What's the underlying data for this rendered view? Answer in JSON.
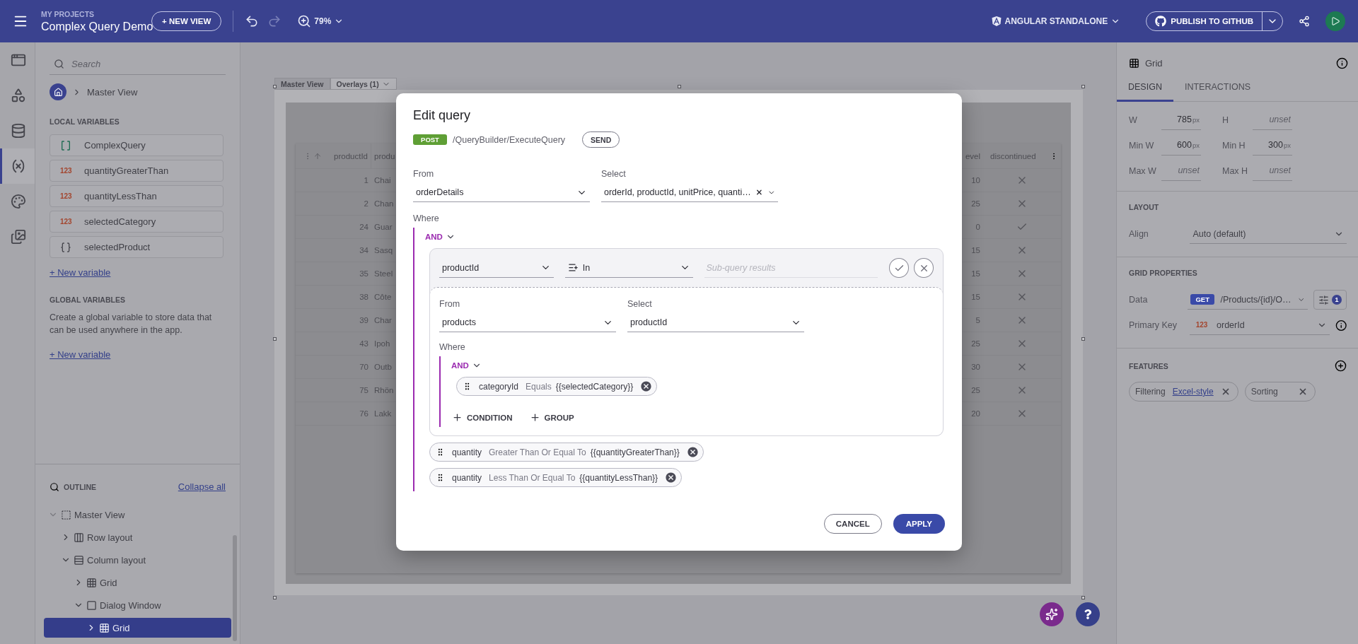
{
  "topbar": {
    "section": "MY PROJECTS",
    "project": "Complex Query Demo",
    "new_view": "+ NEW VIEW",
    "zoom": "79%",
    "framework": "ANGULAR STANDALONE",
    "publish": "PUBLISH TO GITHUB"
  },
  "rail": [
    {
      "kind": "views",
      "selected": false
    },
    {
      "kind": "components",
      "selected": false
    },
    {
      "kind": "data",
      "selected": false
    },
    {
      "kind": "variables",
      "selected": true
    },
    {
      "kind": "theme",
      "selected": false
    },
    {
      "kind": "assets",
      "selected": false
    }
  ],
  "left_panel": {
    "search_placeholder": "Search",
    "breadcrumb": "Master View",
    "local_title": "LOCAL VARIABLES",
    "variables": [
      {
        "kind": "query",
        "name": "ComplexQuery"
      },
      {
        "kind": "number",
        "badge": "123",
        "name": "quantityGreaterThan"
      },
      {
        "kind": "number",
        "badge": "123",
        "name": "quantityLessThan"
      },
      {
        "kind": "number",
        "badge": "123",
        "name": "selectedCategory"
      },
      {
        "kind": "object",
        "name": "selectedProduct"
      }
    ],
    "new_variable": "+ New variable",
    "global_title": "GLOBAL VARIABLES",
    "global_text": "Create a global variable to store data that can be used anywhere in the app.",
    "global_new_variable": "+ New variable"
  },
  "outline": {
    "title": "OUTLINE",
    "collapse": "Collapse all",
    "tree": [
      {
        "label": "Master View",
        "kind": "view",
        "expanded": true,
        "selected": false,
        "children": [
          {
            "label": "Row layout",
            "kind": "row",
            "expanded": false,
            "selected": false
          },
          {
            "label": "Column layout",
            "kind": "column",
            "expanded": true,
            "selected": false,
            "children": [
              {
                "label": "Grid",
                "kind": "grid",
                "expanded": false,
                "selected": false
              },
              {
                "label": "Dialog Window",
                "kind": "dialog",
                "expanded": true,
                "selected": false,
                "children": [
                  {
                    "label": "Grid",
                    "kind": "grid",
                    "expanded": false,
                    "selected": true
                  }
                ]
              }
            ]
          }
        ]
      }
    ]
  },
  "canvas": {
    "breadcrumb": [
      "Master View",
      "Overlays (1)"
    ],
    "grid": {
      "left_headers": [
        "productId",
        "produ"
      ],
      "right_headers": [
        "evel",
        "discontinued"
      ],
      "rows": [
        {
          "product_id": "1",
          "product_name": "Chai",
          "column_3": "10",
          "discontinued": false
        },
        {
          "product_id": "2",
          "product_name": "Chan",
          "column_3": "25",
          "discontinued": false
        },
        {
          "product_id": "24",
          "product_name": "Guar",
          "column_3": "0",
          "discontinued": true
        },
        {
          "product_id": "34",
          "product_name": "Sasq",
          "column_3": "15",
          "discontinued": false
        },
        {
          "product_id": "35",
          "product_name": "Steel",
          "column_3": "15",
          "discontinued": false
        },
        {
          "product_id": "38",
          "product_name": "Côte",
          "column_3": "15",
          "discontinued": false
        },
        {
          "product_id": "39",
          "product_name": "Char",
          "column_3": "5",
          "discontinued": false
        },
        {
          "product_id": "43",
          "product_name": "Ipoh",
          "column_3": "25",
          "discontinued": false
        },
        {
          "product_id": "70",
          "product_name": "Outb",
          "column_3": "30",
          "discontinued": false
        },
        {
          "product_id": "75",
          "product_name": "Rhön",
          "column_3": "25",
          "discontinued": false
        },
        {
          "product_id": "76",
          "product_name": "Lakk",
          "column_3": "20",
          "discontinued": false
        }
      ]
    }
  },
  "dialog": {
    "title": "Edit query",
    "method": "POST",
    "endpoint": "/QueryBuilder/ExecuteQuery",
    "send": "SEND",
    "from_label": "From",
    "from_value": "orderDetails",
    "select_label": "Select",
    "select_value": "orderId, productId, unitPrice, quanti…",
    "where_label": "Where",
    "operator": "AND",
    "subquery": {
      "field": "productId",
      "condition": "In",
      "placeholder": "Sub-query results",
      "from_label": "From",
      "from_value": "products",
      "select_label": "Select",
      "select_value": "productId",
      "where_label": "Where",
      "operator": "AND",
      "conditions": [
        {
          "field": "categoryId",
          "operator": "Equals",
          "value": "{{selectedCategory}}"
        }
      ],
      "add_condition": "CONDITION",
      "add_group": "GROUP"
    },
    "conditions": [
      {
        "field": "quantity",
        "operator": "Greater Than Or Equal To",
        "value": "{{quantityGreaterThan}}"
      },
      {
        "field": "quantity",
        "operator": "Less Than Or Equal To",
        "value": "{{quantityLessThan}}"
      }
    ],
    "cancel": "CANCEL",
    "apply": "APPLY"
  },
  "right_panel": {
    "title": "Grid",
    "tabs": [
      {
        "label": "DESIGN",
        "selected": true
      },
      {
        "label": "INTERACTIONS",
        "selected": false
      }
    ],
    "sizes": [
      {
        "label": "W",
        "value": "785",
        "unit": "px"
      },
      {
        "label": "H",
        "placeholder": "unset"
      },
      {
        "label": "Min W",
        "value": "600",
        "unit": "px"
      },
      {
        "label": "Min H",
        "value": "300",
        "unit": "px"
      },
      {
        "label": "Max W",
        "placeholder": "unset"
      },
      {
        "label": "Max H",
        "placeholder": "unset"
      }
    ],
    "layout_title": "LAYOUT",
    "align_label": "Align",
    "align_value": "Auto (default)",
    "grid_title": "GRID PROPERTIES",
    "data_label": "Data",
    "data_method": "GET",
    "data_value": "/Products/{id}/O…",
    "data_count": "1",
    "key_label": "Primary Key",
    "key_badge": "123",
    "key_value": "orderId",
    "features_title": "FEATURES",
    "features": [
      {
        "label": "Filtering",
        "option": "Excel-style"
      },
      {
        "label": "Sorting"
      }
    ]
  }
}
